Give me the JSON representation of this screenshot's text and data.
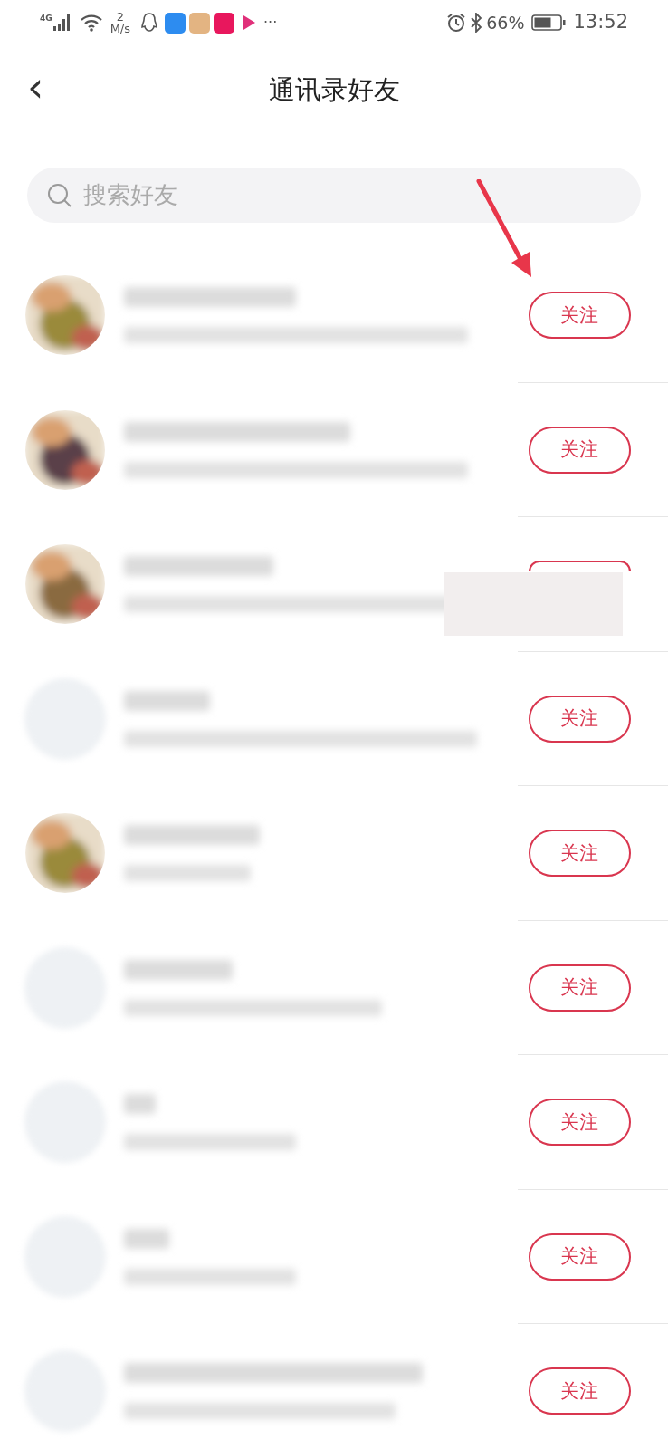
{
  "status_bar": {
    "network": "4G",
    "speed_value": "2",
    "speed_unit": "M/s",
    "more": "···",
    "battery": "66%",
    "time": "13:52"
  },
  "header": {
    "back": "‹",
    "title": "通讯录好友"
  },
  "search": {
    "placeholder": "搜索好友"
  },
  "annotation": {
    "kind": "arrow"
  },
  "contacts": [
    {
      "button": {
        "label": "关注",
        "covered": false
      }
    },
    {
      "button": {
        "label": "关注",
        "covered": false
      }
    },
    {
      "button": {
        "covered": true
      }
    },
    {
      "kind": "blank",
      "button": {
        "label": "关注",
        "covered": false
      }
    },
    {
      "button": {
        "label": "关注",
        "covered": false
      }
    },
    {
      "kind": "blank",
      "button": {
        "label": "关注",
        "covered": false
      }
    },
    {
      "kind": "blank",
      "button": {
        "label": "关注",
        "covered": false
      }
    },
    {
      "kind": "blank",
      "button": {
        "label": "关注",
        "covered": false
      }
    },
    {
      "kind": "blank",
      "button": {
        "label": "关注",
        "covered": false
      }
    }
  ]
}
